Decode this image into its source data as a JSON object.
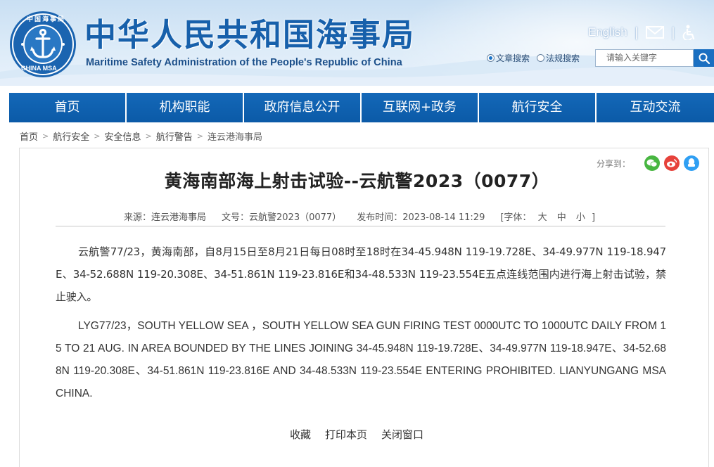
{
  "header": {
    "title_cn": "中华人民共和国海事局",
    "title_en": "Maritime Safety Administration of the People's Republic of China",
    "logo_text_top": "中国海事局",
    "logo_text_bottom": "CHINA MSA",
    "english_link": "English",
    "email_icon": "mail-icon",
    "accessibility_icon": "accessibility-icon",
    "search": {
      "option_article": "文章搜索",
      "option_law": "法规搜索",
      "selected": "文章搜索",
      "placeholder": "请输入关键字"
    }
  },
  "nav": {
    "items": [
      "首页",
      "机构职能",
      "政府信息公开",
      "互联网+政务",
      "航行安全",
      "互动交流"
    ]
  },
  "breadcrumb": {
    "items": [
      "首页",
      "航行安全",
      "安全信息",
      "航行警告",
      "连云港海事局"
    ]
  },
  "share": {
    "label": "分享到：",
    "icons": [
      "wechat-icon",
      "weibo-icon",
      "qq-icon"
    ]
  },
  "article": {
    "title": "黄海南部海上射击试验--云航警2023（0077）",
    "source": "来源：连云港海事局",
    "doc_no": "文号：云航警2023（0077）",
    "publish_time": "发布时间：2023-08-14 11:29",
    "font_size_label_open": "[字体：",
    "font_large": "大",
    "font_medium": "中",
    "font_small": "小",
    "font_size_label_close": "]",
    "para_cn": "云航警77/23，黄海南部，自8月15日至8月21日每日08时至18时在34-45.948N 119-19.728E、34-49.977N 119-18.947E、34-52.688N 119-20.308E、34-51.861N 119-23.816E和34-48.533N 119-23.554E五点连线范围内进行海上射击试验，禁止驶入。",
    "para_en": "LYG77/23，SOUTH YELLOW SEA ，SOUTH YELLOW SEA GUN FIRING TEST 0000UTC TO 1000UTC DAILY FROM 15 TO 21 AUG. IN AREA BOUNDED BY THE LINES JOINING 34-45.948N 119-19.728E、34-49.977N 119-18.947E、34-52.688N 119-20.308E、34-51.861N 119-23.816E AND 34-48.533N 119-23.554E ENTERING PROHIBITED. LIANYUNGANG MSA CHINA."
  },
  "actions": {
    "favorite": "收藏",
    "print": "打印本页",
    "close": "关闭窗口"
  },
  "colors": {
    "brand_blue": "#1760ab",
    "nav_blue": "#0c5aa6"
  }
}
